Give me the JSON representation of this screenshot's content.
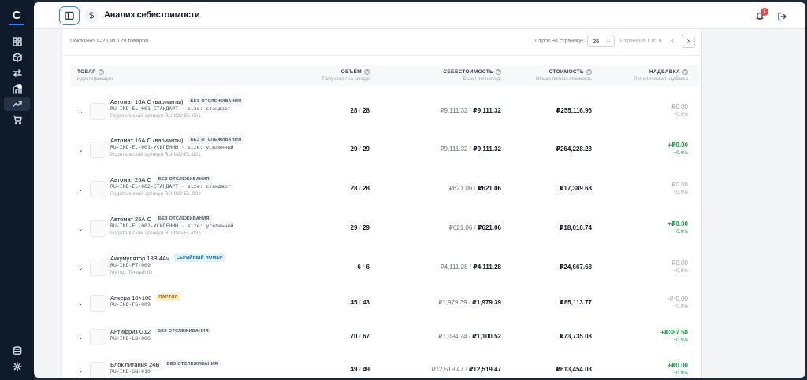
{
  "sidebar": {
    "logo": "C",
    "icons": [
      "dashboard-icon",
      "box-icon",
      "transfer-icon",
      "warehouse-icon",
      "trending-up-icon",
      "cart-icon",
      "database-icon",
      "settings-icon"
    ]
  },
  "header": {
    "title": "Анализ себестоимости",
    "currency_icon": "$",
    "notifications_count": "1"
  },
  "pager": {
    "showing": "Показано 1–25 из 129 товаров",
    "rows_per_page_label": "Строк на странице",
    "rows_per_page": "25",
    "page_info": "Страница 1 из 6",
    "prev": "‹",
    "next": "›"
  },
  "columns": {
    "product": {
      "label": "ТОВАР",
      "sub": "Идентификация"
    },
    "volume": {
      "label": "ОБЪЁМ",
      "sub": "Получено / на складе"
    },
    "cost": {
      "label": "СЕБЕСТОИМОСТЬ",
      "sub": "База / полная/ед."
    },
    "value": {
      "label": "СТОИМОСТЬ",
      "sub": "Общая полная стоимость"
    },
    "markup": {
      "label": "НАДБАВКА",
      "sub": "Логистическая надбавка"
    }
  },
  "rows": [
    {
      "name": "Автомат 16А С (варианты)",
      "tag": "БЕЗ ОТСЛЕЖИВАНИЯ",
      "tag_type": "none",
      "sku": "RU-IND-EL-001-СТАНДАРТ · size: стандарт",
      "parent": "Родительский артикул RU-IND-EL-001",
      "received": "28",
      "stock": "28",
      "base": "₽9,111.32",
      "full": "₽9,111.32",
      "value": "₽255,116.96",
      "markup": "₽0.00",
      "markup_pct": "+0.0%",
      "markup_type": "zero"
    },
    {
      "name": "Автомат 16А С (варианты)",
      "tag": "БЕЗ ОТСЛЕЖИВАНИЯ",
      "tag_type": "none",
      "sku": "RU-IND-EL-001-УСИЛЕННЫ · size: усиленный",
      "parent": "Родительский артикул RU-IND-EL-001",
      "received": "29",
      "stock": "29",
      "base": "₽9,111.32",
      "full": "₽9,111.32",
      "value": "₽264,228.28",
      "markup": "+₽0.00",
      "markup_pct": "+0.0%",
      "markup_type": "pos"
    },
    {
      "name": "Автомат 25А С",
      "tag": "БЕЗ ОТСЛЕЖИВАНИЯ",
      "tag_type": "none",
      "sku": "RU-IND-EL-002-СТАНДАРТ · size: стандарт",
      "parent": "Родительский артикул RU-IND-EL-002",
      "received": "28",
      "stock": "28",
      "base": "₽621.06",
      "full": "₽621.06",
      "value": "₽17,389.68",
      "markup": "₽0.00",
      "markup_pct": "+0.0%",
      "markup_type": "zero"
    },
    {
      "name": "Автомат 25А С",
      "tag": "БЕЗ ОТСЛЕЖИВАНИЯ",
      "tag_type": "none",
      "sku": "RU-IND-EL-002-УСИЛЕННЫ · size: усиленный",
      "parent": "Родительский артикул RU-IND-EL-002",
      "received": "29",
      "stock": "29",
      "base": "₽621.06",
      "full": "₽621.06",
      "value": "₽18,010.74",
      "markup": "+₽0.00",
      "markup_pct": "+0.0%",
      "markup_type": "pos"
    },
    {
      "name": "Аккумулятор 18В 4Ач",
      "tag": "СЕРИЙНЫЙ НОМЕР",
      "tag_type": "serial",
      "sku": "RU-IND-PT-009",
      "parent": "Метод: Точный ID",
      "received": "6",
      "stock": "6",
      "base": "₽4,111.28",
      "full": "₽4,111.28",
      "value": "₽24,667.68",
      "markup": "₽0.00",
      "markup_pct": "+0.0%",
      "markup_type": "zero"
    },
    {
      "name": "Анкера 10×100",
      "tag": "ПАРТИЯ",
      "tag_type": "batch",
      "sku": "RU-IND-FS-009",
      "parent": "",
      "received": "45",
      "stock": "43",
      "base": "₽1,979.39",
      "full": "₽1,979.39",
      "value": "₽85,113.77",
      "markup": "-₽-0.00",
      "markup_pct": "+0.0%",
      "markup_type": "zero"
    },
    {
      "name": "Антифриз G12",
      "tag": "БЕЗ ОТСЛЕЖИВАНИЯ",
      "tag_type": "none",
      "sku": "RU-IND-LB-006",
      "parent": "",
      "received": "70",
      "stock": "67",
      "base": "₽1,094.74",
      "full": "₽1,100.52",
      "value": "₽73,735.08",
      "markup": "+₽387.50",
      "markup_pct": "+0.5%",
      "markup_type": "pos"
    },
    {
      "name": "Блок питания 24В",
      "tag": "БЕЗ ОТСЛЕЖИВАНИЯ",
      "tag_type": "none",
      "sku": "RU-IND-SN-010",
      "parent": "",
      "received": "49",
      "stock": "49",
      "base": "₽12,519.47",
      "full": "₽12,519.47",
      "value": "₽613,454.03",
      "markup": "+₽0.00",
      "markup_pct": "+0.0%",
      "markup_type": "pos"
    }
  ]
}
